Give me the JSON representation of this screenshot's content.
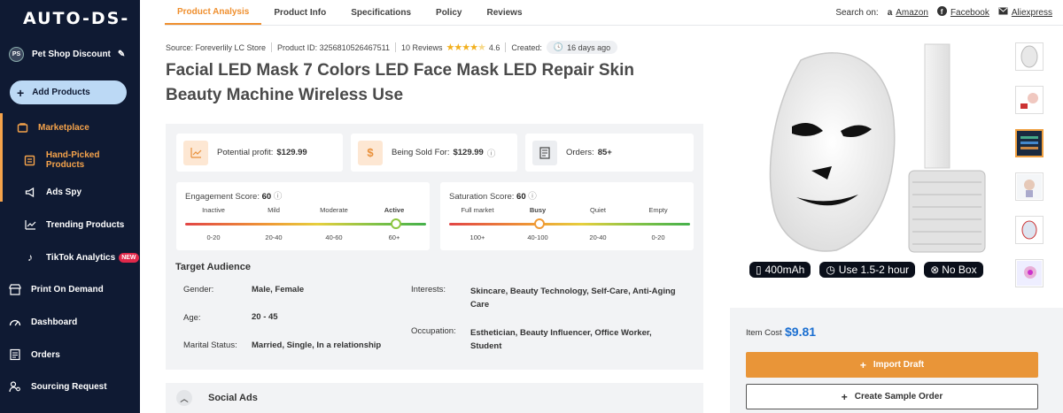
{
  "sidebar": {
    "logo": "AUTO-DS-",
    "store": {
      "initials": "PS",
      "name": "Pet Shop Discount"
    },
    "add_products": "Add Products",
    "items": [
      {
        "label": "Marketplace",
        "icon": "marketplace-icon"
      },
      {
        "label": "Hand-Picked Products",
        "icon": "hand-picked-icon"
      },
      {
        "label": "Ads Spy",
        "icon": "megaphone-icon"
      },
      {
        "label": "Trending Products",
        "icon": "trending-icon"
      },
      {
        "label": "TikTok Analytics",
        "icon": "tiktok-icon",
        "badge": "NEW"
      },
      {
        "label": "Print On Demand",
        "icon": "store-icon"
      },
      {
        "label": "Dashboard",
        "icon": "gauge-icon"
      },
      {
        "label": "Orders",
        "icon": "orders-icon"
      },
      {
        "label": "Sourcing Request",
        "icon": "sourcing-icon"
      }
    ]
  },
  "tabs": [
    "Product Analysis",
    "Product Info",
    "Specifications",
    "Policy",
    "Reviews"
  ],
  "search_on": {
    "label": "Search on:",
    "links": [
      {
        "icon": "amazon-icon",
        "label": "Amazon"
      },
      {
        "icon": "facebook-icon",
        "label": "Facebook"
      },
      {
        "icon": "mail-icon",
        "label": "Aliexpress"
      }
    ]
  },
  "meta": {
    "source": "Source: Foreverlily LC Store",
    "product_id": "Product ID: 3256810526467511",
    "reviews": "10 Reviews",
    "rating": "4.6",
    "created_label": "Created:",
    "created_value": "16 days ago"
  },
  "title": "Facial LED Mask 7 Colors LED Face Mask LED Repair Skin Beauty Machine Wireless Use",
  "kpis": [
    {
      "label": "Potential profit:",
      "value": "$129.99",
      "icon": "chart-icon"
    },
    {
      "label": "Being Sold For:",
      "value": "$129.99",
      "icon": "dollar-icon"
    },
    {
      "label": "Orders:",
      "value": "85+",
      "icon": "orders-doc-icon"
    }
  ],
  "engagement": {
    "label": "Engagement Score:",
    "score": "60",
    "levels": [
      "Inactive",
      "Mild",
      "Moderate",
      "Active"
    ],
    "ranges": [
      "0-20",
      "20-40",
      "40-60",
      "60+"
    ],
    "active_index": 3
  },
  "saturation": {
    "label": "Saturation Score:",
    "score": "60",
    "levels": [
      "Full market",
      "Busy",
      "Quiet",
      "Empty"
    ],
    "ranges": [
      "100+",
      "40-100",
      "20-40",
      "0-20"
    ],
    "active_index": 1
  },
  "target": {
    "heading": "Target Audience",
    "gender_label": "Gender:",
    "gender": "Male, Female",
    "age_label": "Age:",
    "age": "20 - 45",
    "marital_label": "Marital Status:",
    "marital": "Married, Single, In a relationship",
    "interests_label": "Interests:",
    "interests": "Skincare, Beauty Technology, Self-Care, Anti-Aging Care",
    "occupation_label": "Occupation:",
    "occupation": "Esthetician, Beauty Influencer, Office Worker, Student"
  },
  "social_ads": "Social Ads",
  "product_chips": [
    "400mAh",
    "Use 1.5-2 hour",
    "No Box"
  ],
  "item_cost": {
    "label": "Item Cost",
    "value": "$9.81"
  },
  "buttons": {
    "import": "Import Draft",
    "sample": "Create Sample Order"
  }
}
